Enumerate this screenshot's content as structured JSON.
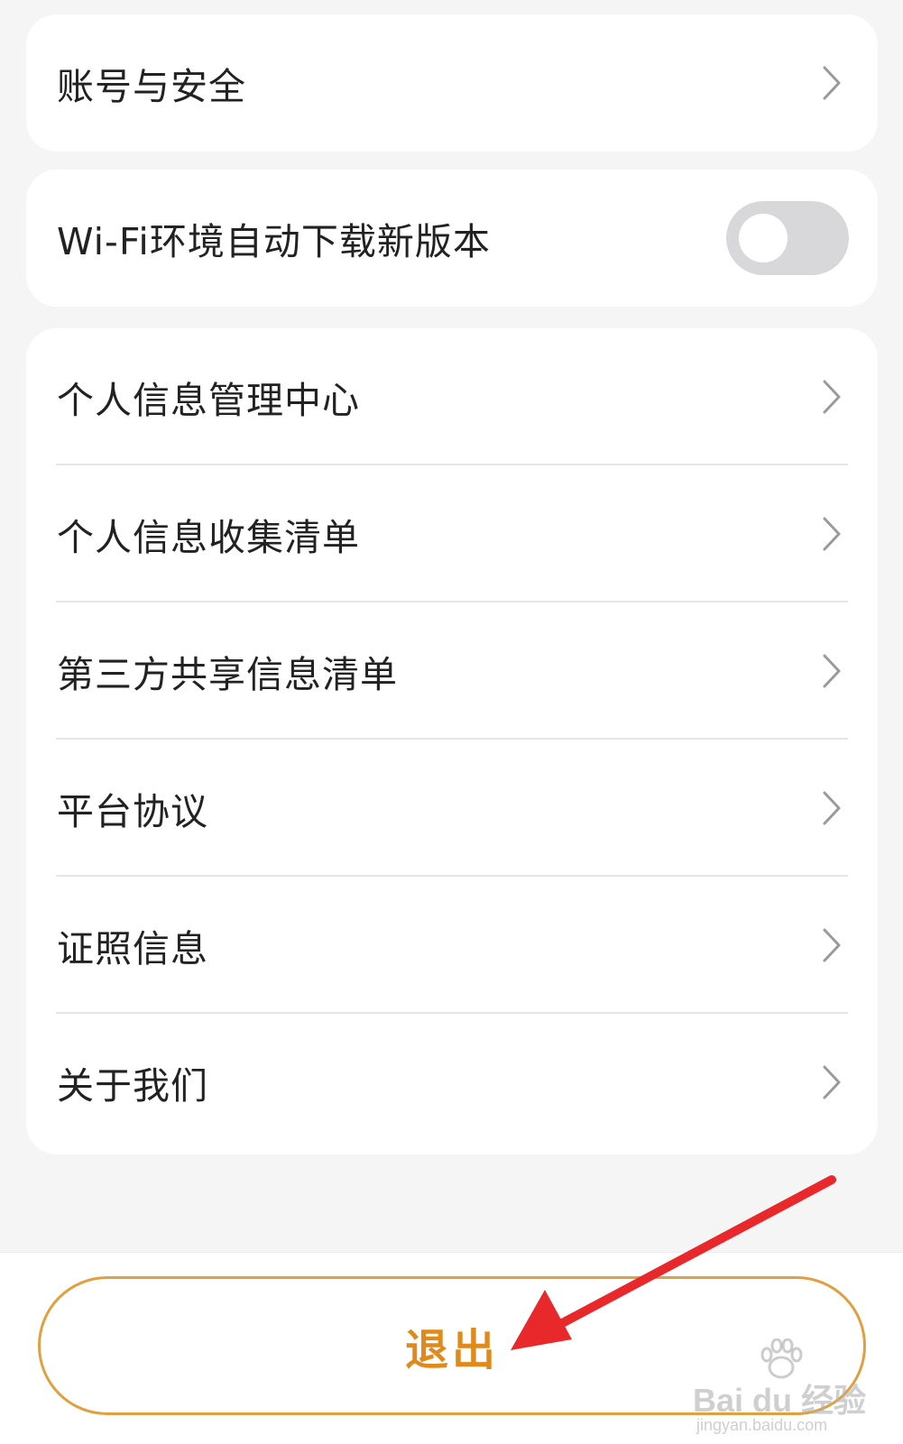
{
  "settings": {
    "account_label": "账号与安全",
    "wifi_label": "Wi-Fi环境自动下载新版本",
    "wifi_toggle_on": false,
    "items": [
      {
        "label": "个人信息管理中心"
      },
      {
        "label": "个人信息收集清单"
      },
      {
        "label": "第三方共享信息清单"
      },
      {
        "label": "平台协议"
      },
      {
        "label": "证照信息"
      },
      {
        "label": "关于我们"
      }
    ]
  },
  "logout": {
    "label": "退出"
  },
  "watermark": {
    "brand": "Bai du 经验",
    "url": "jingyan.baidu.com"
  },
  "colors": {
    "background": "#f5f5f5",
    "card": "#ffffff",
    "accent_orange": "#e08a1c",
    "arrow_red": "#e8282a",
    "toggle_off": "#d8d8db"
  },
  "icons": {
    "chevron": "chevron-right-icon",
    "arrow": "red-arrow-annotation"
  }
}
